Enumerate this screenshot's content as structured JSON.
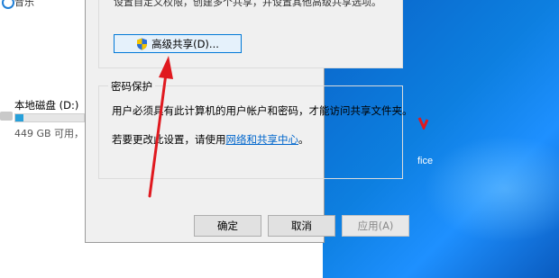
{
  "explorer": {
    "top_label": "音乐",
    "drive": {
      "name": "本地磁盘 (D:)",
      "free_text": "449 GB 可用，",
      "usage_fraction": 0.12
    }
  },
  "dialog": {
    "top_text": "设置自定义权限，创建多个共享，并设置其他高级共享选项。",
    "advanced_share_button": "高级共享(D)...",
    "password_group": {
      "title": "密码保护",
      "description": "用户必须具有此计算机的用户帐户和密码，才能访问共享文件夹。",
      "hint_prefix": "若要更改此设置，请使用",
      "hint_link": "网络和共享中心",
      "hint_suffix": "。"
    },
    "buttons": {
      "ok": "确定",
      "cancel": "取消",
      "apply": "应用(A)"
    }
  },
  "desktop": {
    "label": "fice"
  },
  "colors": {
    "accent": "#0078d7",
    "link": "#0066cc",
    "annotation_arrow": "#e0191f",
    "desktop_blue": "#0d7fe0"
  },
  "icons": {
    "shield": "uac-shield-icon"
  }
}
